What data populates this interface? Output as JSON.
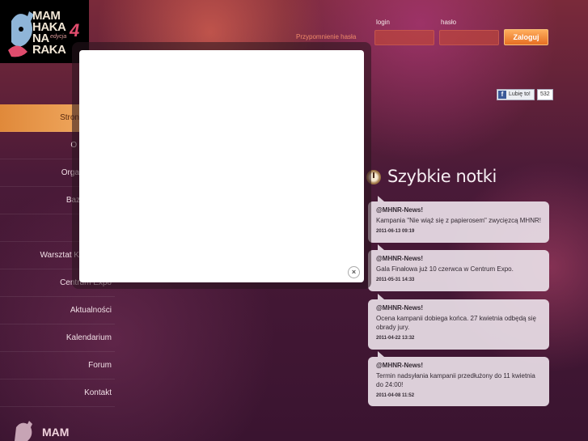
{
  "header": {
    "logo_words": [
      "MAM",
      "HAKA",
      "NA",
      "RAKA"
    ],
    "logo_edition_label": "edycja",
    "logo_edition_number": "4",
    "forgot_password_link": "Przypomnienie hasła",
    "login_label": "login",
    "password_label": "hasło",
    "login_value": "",
    "password_value": "",
    "login_button": "Zaloguj",
    "like_button": "Lubię to!",
    "like_count": "532"
  },
  "nav": {
    "items": [
      {
        "label": "Strona główna"
      },
      {
        "label": "O projekcie"
      },
      {
        "label": "Organizatorzy"
      },
      {
        "label": "Baza wiedzy"
      },
      {
        "label": ""
      },
      {
        "label": "Warsztat Kreatywny"
      },
      {
        "label": "Centrum Expo"
      },
      {
        "label": "Aktualności"
      },
      {
        "label": "Kalendarium"
      },
      {
        "label": "Forum"
      },
      {
        "label": "Kontakt"
      }
    ],
    "bottom_logo_word": "MAM"
  },
  "notes": {
    "title": "Szybkie notki",
    "items": [
      {
        "author": "@MHNR-News!",
        "text": "Kampania \"Nie wiąż się z papierosem\" zwycięzcą MHNR!",
        "date": "2011-06-13 09:19"
      },
      {
        "author": "@MHNR-News!",
        "text": "Gala Finałowa już 10 czerwca w Centrum Expo.",
        "date": "2011-05-31 14:33"
      },
      {
        "author": "@MHNR-News!",
        "text": "Ocena kampanii dobiega końca. 27 kwietnia odbędą się obrady jury.",
        "date": "2011-04-22 13:32"
      },
      {
        "author": "@MHNR-News!",
        "text": "Termin nadsyłania kampanii przedłużony do 11 kwietnia do 24:00!",
        "date": "2011-04-08 11:52"
      }
    ]
  },
  "modal": {
    "close_icon": "close-icon",
    "close_symbol": "×"
  }
}
